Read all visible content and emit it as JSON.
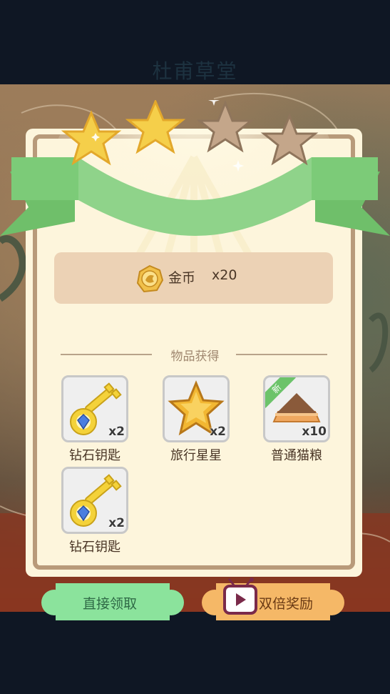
{
  "header": {
    "title": "杜甫草堂"
  },
  "reward": {
    "stars_total": 4,
    "stars_earned": 2,
    "coin": {
      "icon": "gold-coin-icon",
      "label": "金币",
      "quantity": "x20"
    }
  },
  "items_section": {
    "title": "物品获得",
    "items": [
      {
        "name": "钻石钥匙",
        "quantity": "x2",
        "icon": "diamond-key-icon",
        "is_new": false
      },
      {
        "name": "旅行星星",
        "quantity": "x2",
        "icon": "travel-star-icon",
        "is_new": false
      },
      {
        "name": "普通猫粮",
        "quantity": "x10",
        "icon": "cat-food-icon",
        "is_new": true,
        "new_label": "新"
      },
      {
        "name": "钻石钥匙",
        "quantity": "x2",
        "icon": "diamond-key-icon",
        "is_new": false
      }
    ]
  },
  "actions": {
    "claim_label": "直接领取",
    "double_label": "双倍奖励",
    "double_icon": "tv-ad-icon"
  },
  "colors": {
    "ribbon": "#8fd38a",
    "star_gold": "#f5cf4a",
    "star_gray": "#c4a68a",
    "panel": "#fdf5dc",
    "claim_button": "#8be39c",
    "double_button": "#f5b867"
  }
}
